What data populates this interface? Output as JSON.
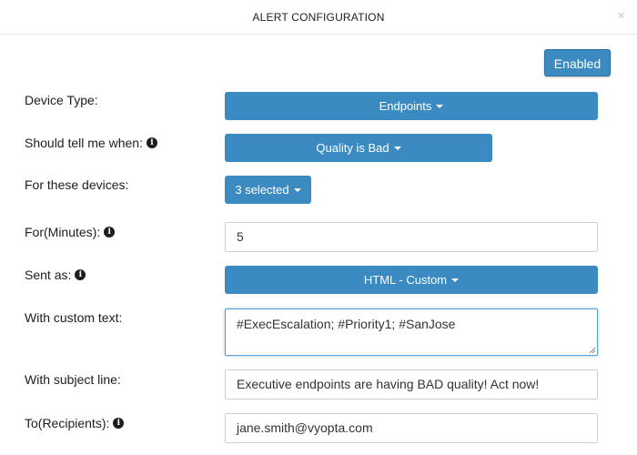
{
  "modal": {
    "title": "ALERT CONFIGURATION",
    "close_symbol": "×"
  },
  "status_button": {
    "label": "Enabled"
  },
  "fields": {
    "device_type": {
      "label": "Device Type:",
      "value": "Endpoints"
    },
    "tell_when": {
      "label": "Should tell me when:",
      "value": "Quality is Bad"
    },
    "devices": {
      "label": "For these devices:",
      "value": "3 selected"
    },
    "minutes": {
      "label": "For(Minutes):",
      "value": "5"
    },
    "sent_as": {
      "label": "Sent as:",
      "value": "HTML - Custom"
    },
    "custom_text": {
      "label": "With custom text:",
      "value": "#ExecEscalation; #Priority1; #SanJose"
    },
    "subject": {
      "label": "With subject line:",
      "value": "Executive endpoints are having BAD quality! Act now!"
    },
    "recipients": {
      "label": "To(Recipients):",
      "value": "jane.smith@vyopta.com"
    }
  },
  "icons": {
    "info": "info-icon",
    "caret": "caret-down-icon",
    "close": "close-icon"
  },
  "colors": {
    "primary_button": "#3b8bc2",
    "focus_border": "#5a9fd4"
  }
}
